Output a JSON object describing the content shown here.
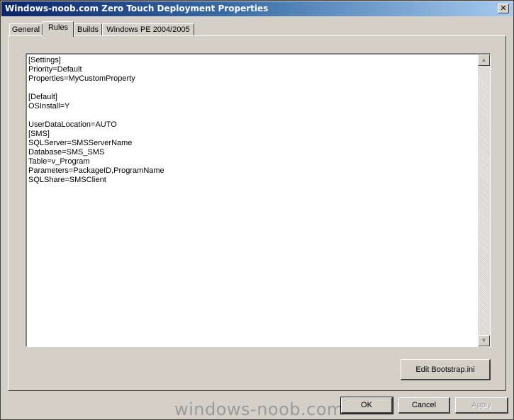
{
  "window": {
    "title": "Windows-noob.com Zero Touch Deployment Properties",
    "close_label": "✕"
  },
  "tabs": [
    {
      "label": "General"
    },
    {
      "label": "Rules"
    },
    {
      "label": "Builds"
    },
    {
      "label": "Windows PE 2004/2005"
    }
  ],
  "rules": {
    "content": "[Settings]\nPriority=Default\nProperties=MyCustomProperty\n\n[Default]\nOSInstall=Y\n\nUserDataLocation=AUTO\n[SMS]\nSQLServer=SMSServerName\nDatabase=SMS_SMS\nTable=v_Program\nParameters=PackageID,ProgramName\nSQLShare=SMSClient",
    "scroll_up": "▲",
    "scroll_down": "▼"
  },
  "buttons": {
    "edit_bootstrap": "Edit Bootstrap.ini",
    "ok": "OK",
    "cancel": "Cancel",
    "apply": "Apply"
  },
  "watermark": "windows-noob.com"
}
